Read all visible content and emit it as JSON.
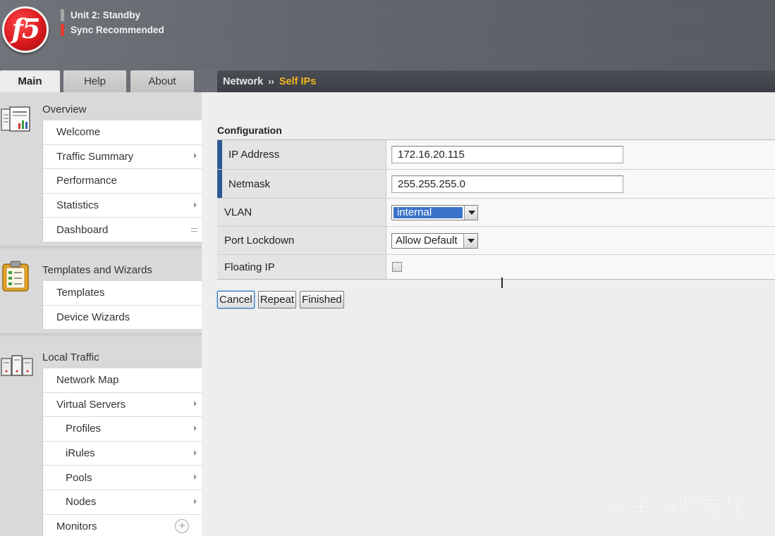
{
  "header": {
    "unit_status": "Unit 2: Standby",
    "sync_status": "Sync Recommended",
    "unit_status_color": "#a6a6a6",
    "sync_status_color": "#e23b30",
    "logo_text": "f5"
  },
  "tabs": [
    {
      "label": "Main",
      "active": true
    },
    {
      "label": "Help",
      "active": false
    },
    {
      "label": "About",
      "active": false
    }
  ],
  "breadcrumb": {
    "section": "Network",
    "separator": "››",
    "current": "Self IPs",
    "current_color": "#f2b51f"
  },
  "sidebar": {
    "overview": {
      "title": "Overview",
      "icon": "report-icon",
      "items": [
        {
          "label": "Welcome",
          "indicator": "none"
        },
        {
          "label": "Traffic Summary",
          "indicator": "arrow"
        },
        {
          "label": "Performance",
          "indicator": "none"
        },
        {
          "label": "Statistics",
          "indicator": "arrow"
        },
        {
          "label": "Dashboard",
          "indicator": "list"
        }
      ]
    },
    "templates": {
      "title": "Templates and Wizards",
      "icon": "clipboard-icon",
      "items": [
        {
          "label": "Templates",
          "indicator": "none"
        },
        {
          "label": "Device Wizards",
          "indicator": "none"
        }
      ]
    },
    "local_traffic": {
      "title": "Local Traffic",
      "icon": "servers-icon",
      "items": [
        {
          "label": "Network Map",
          "indicator": "none"
        },
        {
          "label": "Virtual Servers",
          "indicator": "arrow"
        },
        {
          "label": "Profiles",
          "indicator": "arrow"
        },
        {
          "label": "iRules",
          "indicator": "arrow"
        },
        {
          "label": "Pools",
          "indicator": "arrow"
        },
        {
          "label": "Nodes",
          "indicator": "arrow"
        },
        {
          "label": "Monitors",
          "indicator": "plus"
        }
      ]
    }
  },
  "form": {
    "title": "Configuration",
    "ip_address": {
      "label": "IP Address",
      "value": "172.16.20.115",
      "required": true
    },
    "netmask": {
      "label": "Netmask",
      "value": "255.255.255.0",
      "required": true
    },
    "vlan": {
      "label": "VLAN",
      "selected": "internal"
    },
    "port_lockdown": {
      "label": "Port Lockdown",
      "selected": "Allow Default"
    },
    "floating_ip": {
      "label": "Floating IP",
      "checked": false
    }
  },
  "buttons": {
    "cancel": "Cancel",
    "repeat": "Repeat",
    "finished": "Finished"
  },
  "watermark": "知乎 @杨左屎"
}
